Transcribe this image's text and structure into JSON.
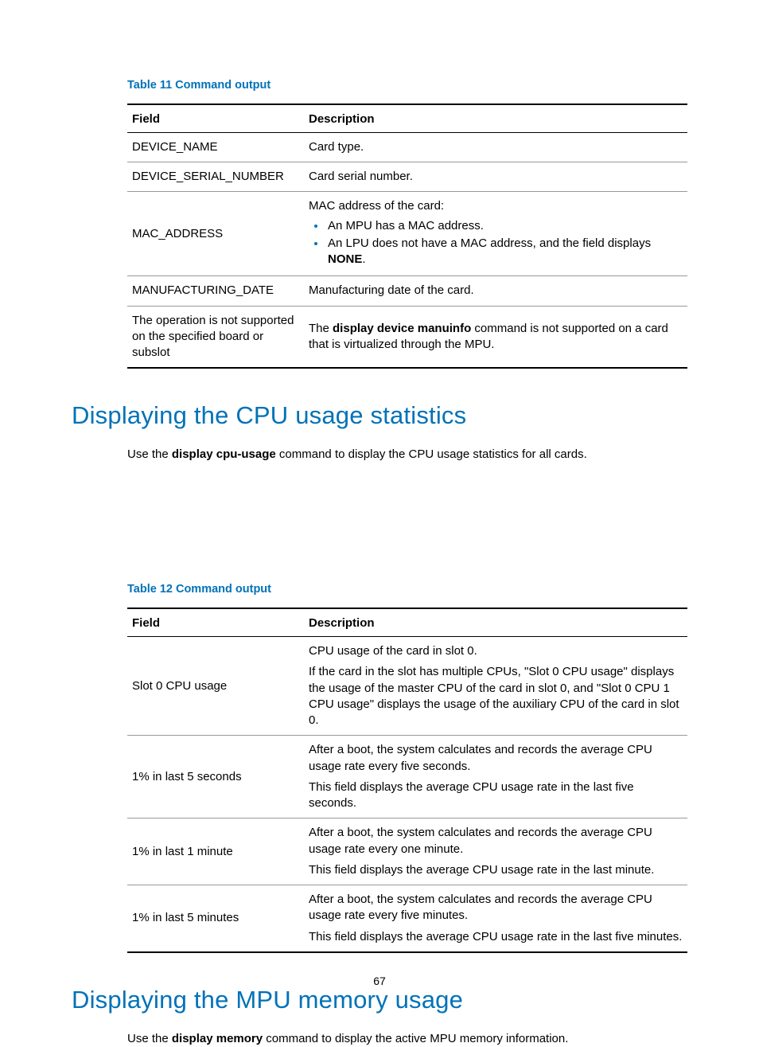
{
  "page_number": "67",
  "table11": {
    "caption": "Table 11 Command output",
    "head_field": "Field",
    "head_desc": "Description",
    "rows": {
      "r0": {
        "field": "DEVICE_NAME",
        "desc": "Card type."
      },
      "r1": {
        "field": "DEVICE_SERIAL_NUMBER",
        "desc": "Card serial number."
      },
      "r2": {
        "field": "MAC_ADDRESS",
        "intro": "MAC address of the card:",
        "b1": "An MPU has a MAC address.",
        "b2_pre": "An LPU does not have a MAC address, and the field displays ",
        "b2_bold": "NONE",
        "b2_post": "."
      },
      "r3": {
        "field": "MANUFACTURING_DATE",
        "desc": "Manufacturing date of the card."
      },
      "r4": {
        "field": "The operation is not supported on the specified board or subslot",
        "pre": "The ",
        "bold": "display device manuinfo",
        "post": " command is not supported on a card that is virtualized through the MPU."
      }
    }
  },
  "section_cpu": {
    "heading": "Displaying the CPU usage statistics",
    "para_pre": "Use the ",
    "para_bold": "display cpu-usage",
    "para_post": " command to display the CPU usage statistics for all cards."
  },
  "table12": {
    "caption": "Table 12 Command output",
    "head_field": "Field",
    "head_desc": "Description",
    "rows": {
      "r0": {
        "field": "Slot 0 CPU usage",
        "p1": "CPU usage of the card in slot 0.",
        "p2": "If the card in the slot has multiple CPUs, \"Slot 0 CPU usage\" displays the usage of the master CPU of the card in slot 0, and \"Slot 0 CPU 1 CPU usage\" displays the usage of the auxiliary CPU of the card in slot 0."
      },
      "r1": {
        "field": "1% in last 5 seconds",
        "p1": "After a boot, the system calculates and records the average CPU usage rate every five seconds.",
        "p2": "This field displays the average CPU usage rate in the last five seconds."
      },
      "r2": {
        "field": "1% in last 1 minute",
        "p1": "After a boot, the system calculates and records the average CPU usage rate every one minute.",
        "p2": "This field displays the average CPU usage rate in the last minute."
      },
      "r3": {
        "field": "1% in last 5 minutes",
        "p1": "After a boot, the system calculates and records the average CPU usage rate every five minutes.",
        "p2": "This field displays the average CPU usage rate in the last five minutes."
      }
    }
  },
  "section_mem": {
    "heading": "Displaying the MPU memory usage",
    "para_pre": "Use the ",
    "para_bold": "display memory",
    "para_post": " command to display the active MPU memory information."
  }
}
